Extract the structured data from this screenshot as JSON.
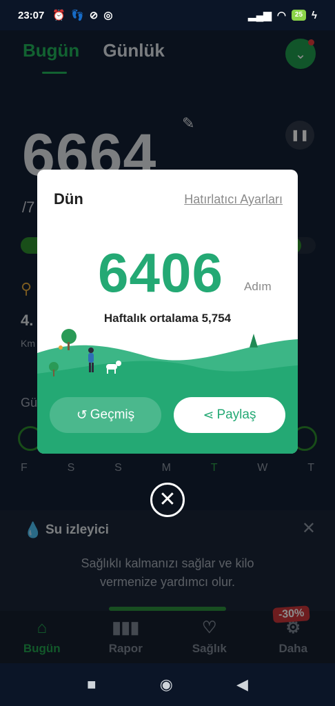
{
  "status_bar": {
    "time": "23:07",
    "left_icons": [
      "alarm-icon",
      "steps-icon",
      "blocked-icon",
      "instagram-icon"
    ],
    "battery": "25"
  },
  "header": {
    "tab_today": "Bugün",
    "tab_daily": "Günlük"
  },
  "background": {
    "steps": "6664",
    "goal_fraction": "/7",
    "progress_fraction": 0.95,
    "distance": "4.",
    "distance_unit": "Km",
    "weekly_label": "Gü",
    "days": [
      "F",
      "S",
      "S",
      "M",
      "T",
      "W",
      "T"
    ],
    "water": {
      "title": "Su izleyici",
      "desc": "Sağlıklı kalmanızı sağlar ve kilo vermenize yardımcı olur."
    },
    "discount": "-30%"
  },
  "bottom_nav": [
    {
      "label": "Bugün",
      "icon": "home-icon",
      "active": true
    },
    {
      "label": "Rapor",
      "icon": "bar-chart-icon",
      "active": false
    },
    {
      "label": "Sağlık",
      "icon": "heart-pulse-icon",
      "active": false
    },
    {
      "label": "Daha",
      "icon": "more-icon",
      "active": false
    }
  ],
  "dialog": {
    "title": "Dün",
    "link": "Hatırlatıcı Ayarları",
    "steps": "6406",
    "unit": "Adım",
    "avg": "Haftalık ortalama 5,754",
    "history_label": "Geçmiş",
    "share_label": "Paylaş"
  },
  "colors": {
    "accent": "#24a974",
    "nav_active": "#22a14d",
    "background": "#132034"
  }
}
